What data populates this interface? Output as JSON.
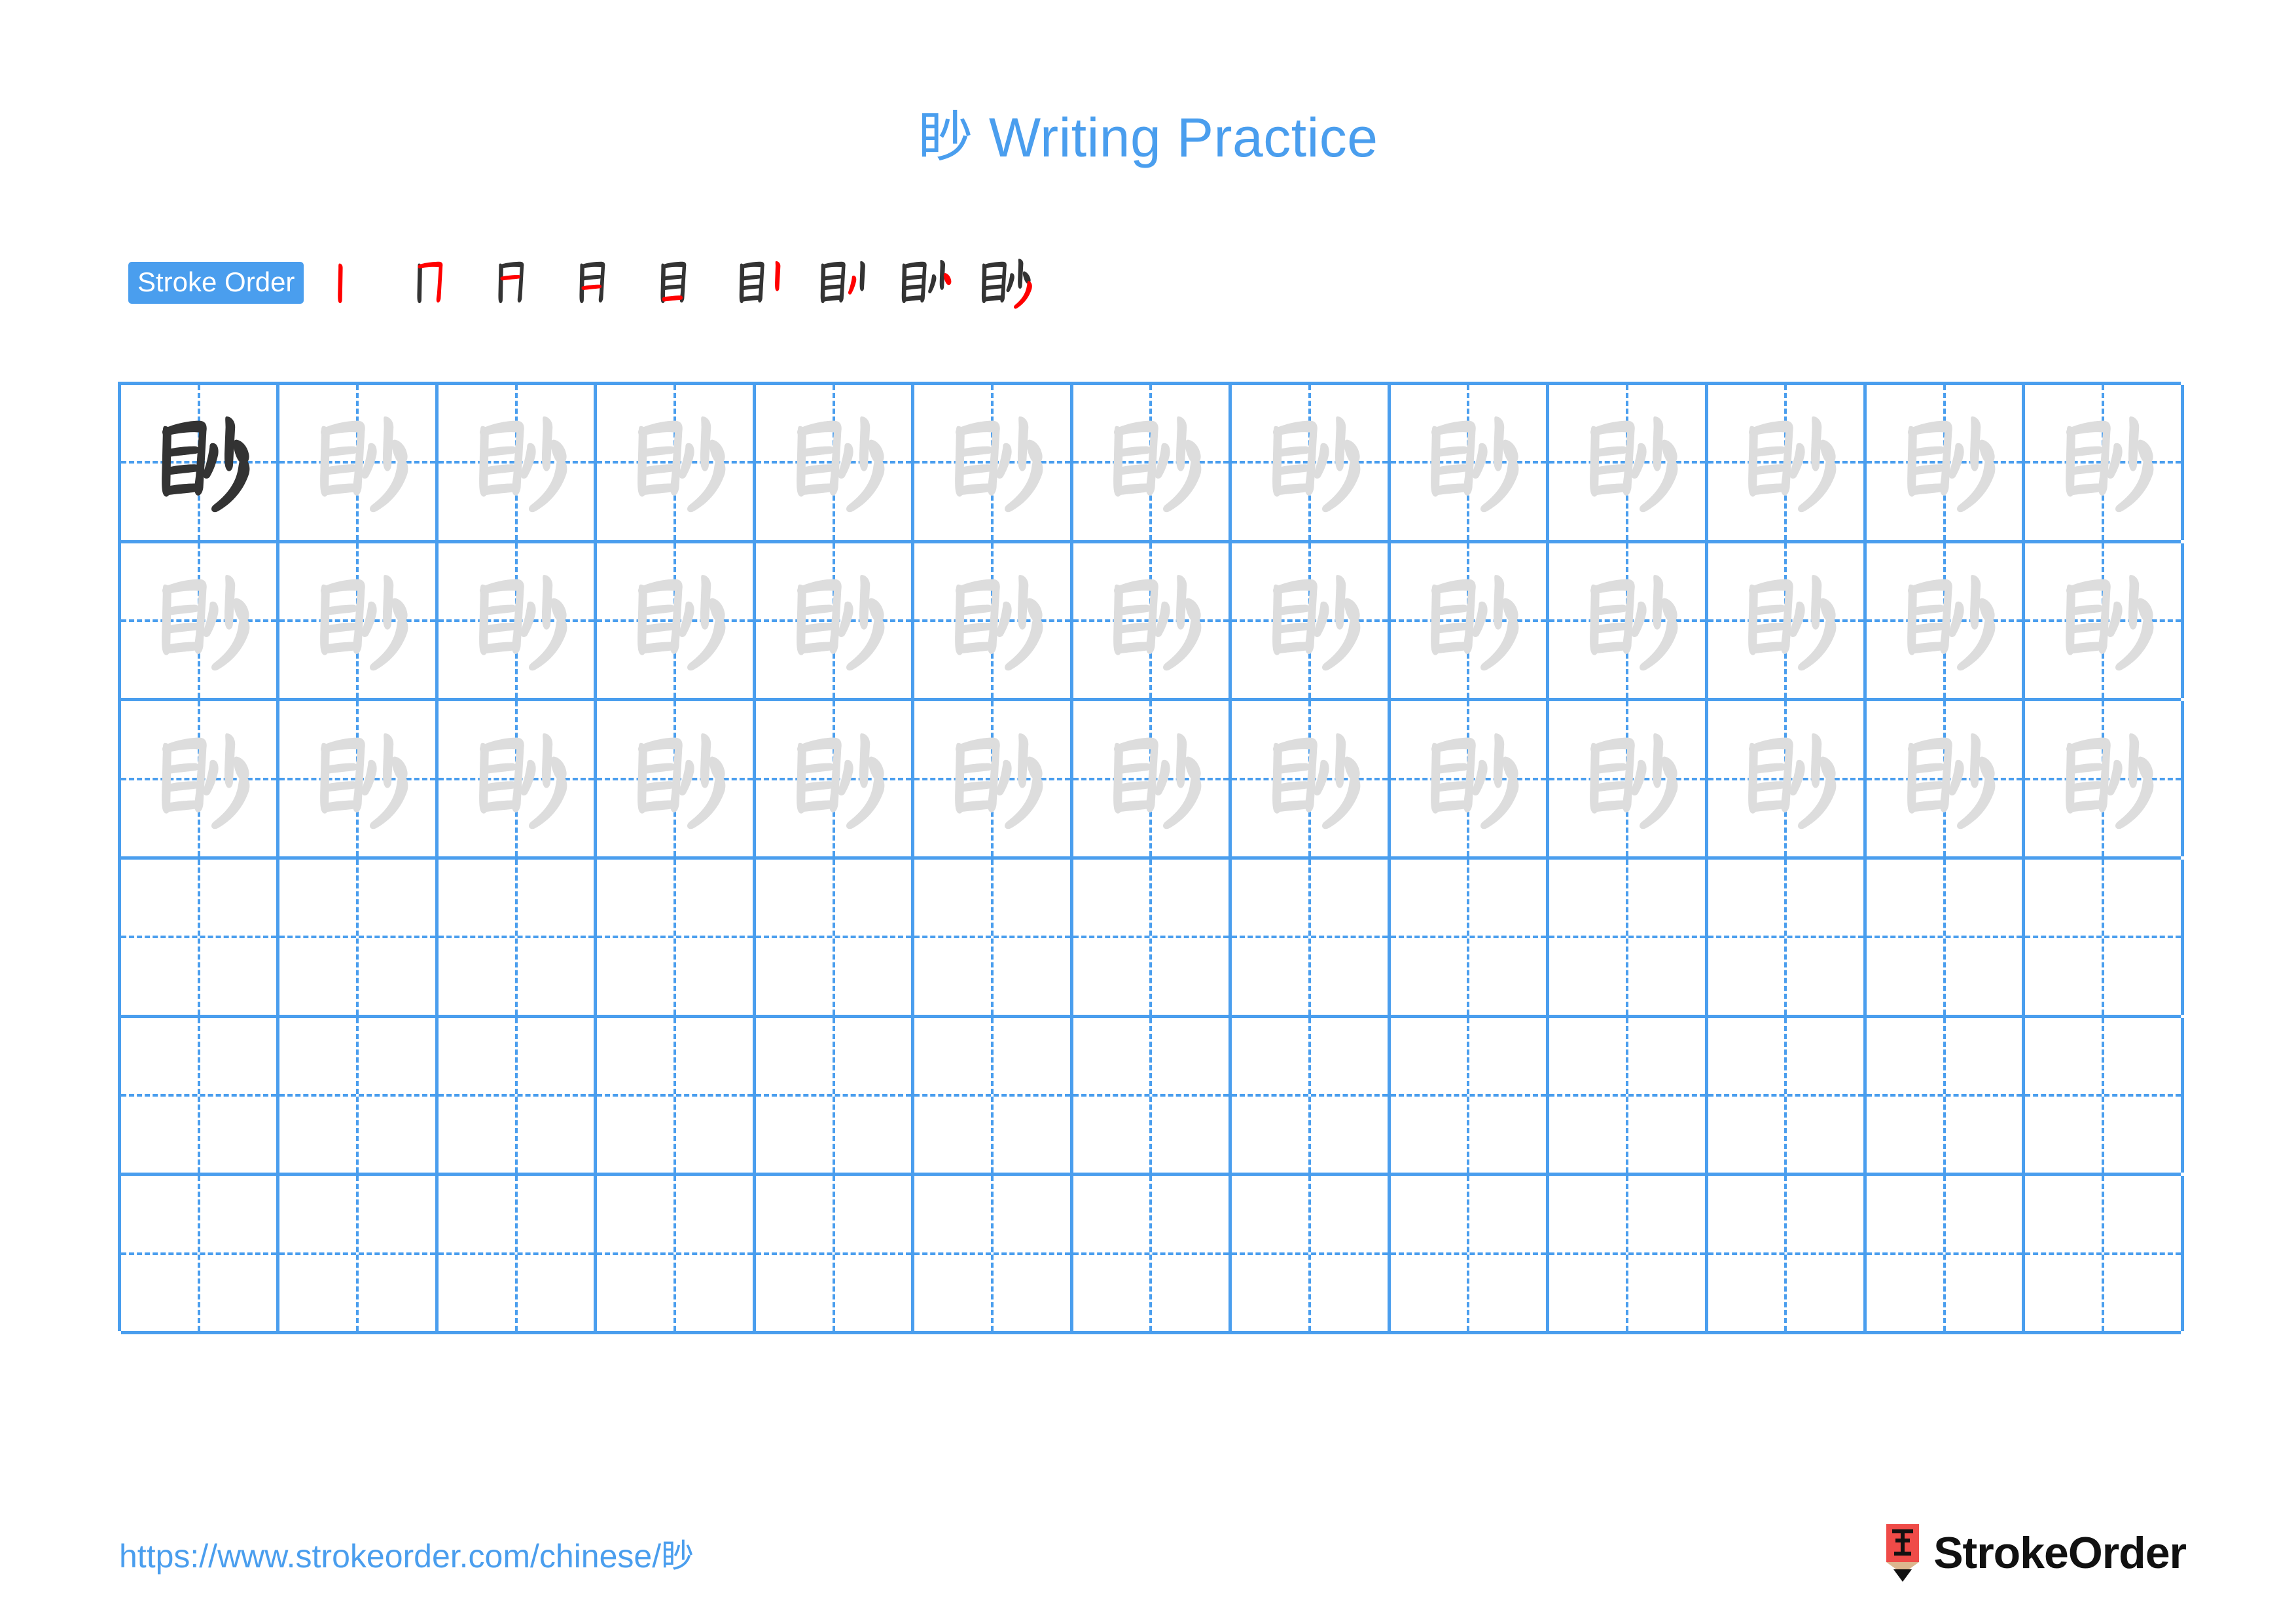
{
  "page": {
    "character": "眇",
    "title": "眇 Writing Practice",
    "title_color": "#4a9eee",
    "background_color": "#ffffff"
  },
  "stroke_order": {
    "badge_label": "Stroke Order",
    "badge_bg_color": "#4a9eee",
    "badge_text_color": "#ffffff",
    "total_strokes": 9,
    "new_stroke_color": "#ff0000",
    "existing_stroke_color": "#333333",
    "steps": [
      {
        "index": 1,
        "new_stroke": "竖 (vertical)",
        "glyph": "丨"
      },
      {
        "index": 2,
        "new_stroke": "横折钩 (horizontal-turn-hook)",
        "glyph": "冂"
      },
      {
        "index": 3,
        "new_stroke": "横 (horizontal)",
        "glyph": "月"
      },
      {
        "index": 4,
        "new_stroke": "横 (horizontal)",
        "glyph": "月"
      },
      {
        "index": 5,
        "new_stroke": "横 (horizontal)",
        "glyph": "目"
      },
      {
        "index": 6,
        "new_stroke": "竖 (vertical)",
        "glyph": "目丨"
      },
      {
        "index": 7,
        "new_stroke": "撇 (left-falling)",
        "glyph": "目丨丿"
      },
      {
        "index": 8,
        "new_stroke": "点 (dot)",
        "glyph": "目小"
      },
      {
        "index": 9,
        "new_stroke": "撇 (long left-falling)",
        "glyph": "眇"
      }
    ]
  },
  "practice_grid": {
    "columns": 13,
    "rows": 6,
    "grid_line_color": "#4a9eee",
    "guide_line_color": "#4a9eee",
    "model_glyph_color": "#333333",
    "trace_glyph_color": "#dddddd",
    "row_contents": [
      {
        "row": 1,
        "model_cells": 1,
        "trace_cells": 12,
        "blank_cells": 0
      },
      {
        "row": 2,
        "model_cells": 0,
        "trace_cells": 13,
        "blank_cells": 0
      },
      {
        "row": 3,
        "model_cells": 0,
        "trace_cells": 13,
        "blank_cells": 0
      },
      {
        "row": 4,
        "model_cells": 0,
        "trace_cells": 0,
        "blank_cells": 13
      },
      {
        "row": 5,
        "model_cells": 0,
        "trace_cells": 0,
        "blank_cells": 13
      },
      {
        "row": 6,
        "model_cells": 0,
        "trace_cells": 0,
        "blank_cells": 13
      }
    ]
  },
  "footer": {
    "url": "https://www.strokeorder.com/chinese/眇",
    "url_color": "#4a9eee",
    "brand_name": "StrokeOrder",
    "brand_mark_character": "字",
    "brand_mark_color": "#ef4b48",
    "brand_mark_wood_color": "#dcb68e"
  }
}
